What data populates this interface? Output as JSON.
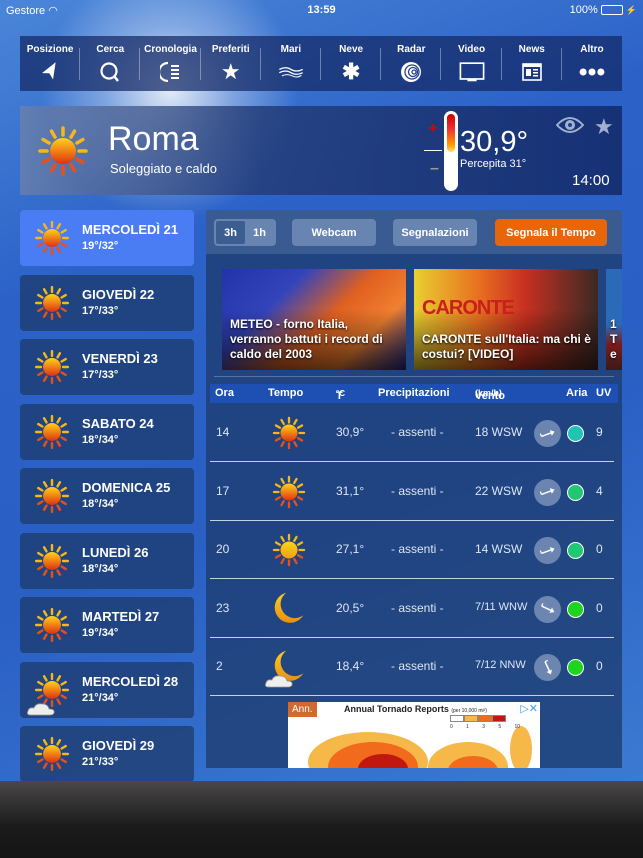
{
  "status_bar": {
    "carrier": "Gestore",
    "time": "13:59",
    "battery": "100%"
  },
  "toolbar": {
    "items": [
      {
        "label": "Posizione",
        "icon": "location-arrow-icon"
      },
      {
        "label": "Cerca",
        "icon": "search-icon"
      },
      {
        "label": "Cronologia",
        "icon": "history-icon"
      },
      {
        "label": "Preferiti",
        "icon": "star-icon"
      },
      {
        "label": "Mari",
        "icon": "waves-icon"
      },
      {
        "label": "Neve",
        "icon": "snowflake-icon"
      },
      {
        "label": "Radar",
        "icon": "radar-icon"
      },
      {
        "label": "Video",
        "icon": "tv-icon"
      },
      {
        "label": "News",
        "icon": "newspaper-icon"
      },
      {
        "label": "Altro",
        "icon": "more-dots-icon"
      }
    ]
  },
  "current": {
    "city": "Roma",
    "description": "Soleggiato e caldo",
    "temperature": "30,9°",
    "perceived": "Percepita 31°",
    "time": "14:00",
    "icon": "sun-icon"
  },
  "days": [
    {
      "name": "MERCOLEDÌ 21",
      "range": "19°/32°",
      "icon": "sun",
      "active": true
    },
    {
      "name": "GIOVEDÌ 22",
      "range": "17°/33°",
      "icon": "sun"
    },
    {
      "name": "VENERDÌ 23",
      "range": "17°/33°",
      "icon": "sun"
    },
    {
      "name": "SABATO 24",
      "range": "18°/34°",
      "icon": "sun"
    },
    {
      "name": "DOMENICA 25",
      "range": "18°/34°",
      "icon": "sun"
    },
    {
      "name": "LUNEDÌ 26",
      "range": "18°/34°",
      "icon": "sun"
    },
    {
      "name": "MARTEDÌ 27",
      "range": "19°/34°",
      "icon": "sun"
    },
    {
      "name": "MERCOLEDÌ 28",
      "range": "21°/34°",
      "icon": "sun-cloud"
    },
    {
      "name": "GIOVEDÌ 29",
      "range": "21°/33°",
      "icon": "sun"
    }
  ],
  "tabs": {
    "interval_3h": "3h",
    "interval_1h": "1h",
    "selected_interval": "3h",
    "webcam": "Webcam",
    "reports": "Segnalazioni",
    "report_weather": "Segnala il Tempo",
    "accent": "#e8650a"
  },
  "news": [
    {
      "title": "METEO - forno Italia, verranno battuti i record di caldo del 2003"
    },
    {
      "title": "CARONTE sull'Italia: ma chi è costui? [VIDEO]",
      "image_text": "CARONTE"
    },
    {
      "title": "1 T e"
    }
  ],
  "table": {
    "headers": {
      "hour": "Ora",
      "weather": "Tempo",
      "temp": "T",
      "temp_unit": "°C",
      "precip": "Precipitazioni",
      "wind": "Vento",
      "wind_unit": "(km/h)",
      "air": "Aria",
      "uv": "UV"
    },
    "rows": [
      {
        "hour": "14",
        "icon": "sun",
        "temp": "30,9°",
        "precip": "- assenti -",
        "wind": "18 WSW",
        "wind_dir": "WSW",
        "air_color": "#1fc4b4",
        "uv": "9"
      },
      {
        "hour": "17",
        "icon": "sun",
        "temp": "31,1°",
        "precip": "- assenti -",
        "wind": "22 WSW",
        "wind_dir": "WSW",
        "air_color": "#22c773",
        "uv": "4"
      },
      {
        "hour": "20",
        "icon": "sun-light",
        "temp": "27,1°",
        "precip": "- assenti -",
        "wind": "14 WSW",
        "wind_dir": "WSW",
        "air_color": "#22c773",
        "uv": "0"
      },
      {
        "hour": "23",
        "icon": "moon",
        "temp": "20,5°",
        "precip": "- assenti -",
        "wind": "7/11 WNW",
        "wind_dir": "WNW",
        "air_color": "#1fd41f",
        "uv": "0"
      },
      {
        "hour": "2",
        "icon": "moon-cloud",
        "temp": "18,4°",
        "precip": "- assenti -",
        "wind": "7/12 NNW",
        "wind_dir": "NNW",
        "air_color": "#1fd41f",
        "uv": "0"
      }
    ]
  },
  "ad": {
    "badge": "Ann.",
    "title": "Annual Tornado Reports",
    "subtitle": "(per 10,000 mi²)",
    "legend_values": [
      "0",
      "1",
      "3",
      "5",
      "10"
    ],
    "controls": "▷✕"
  }
}
